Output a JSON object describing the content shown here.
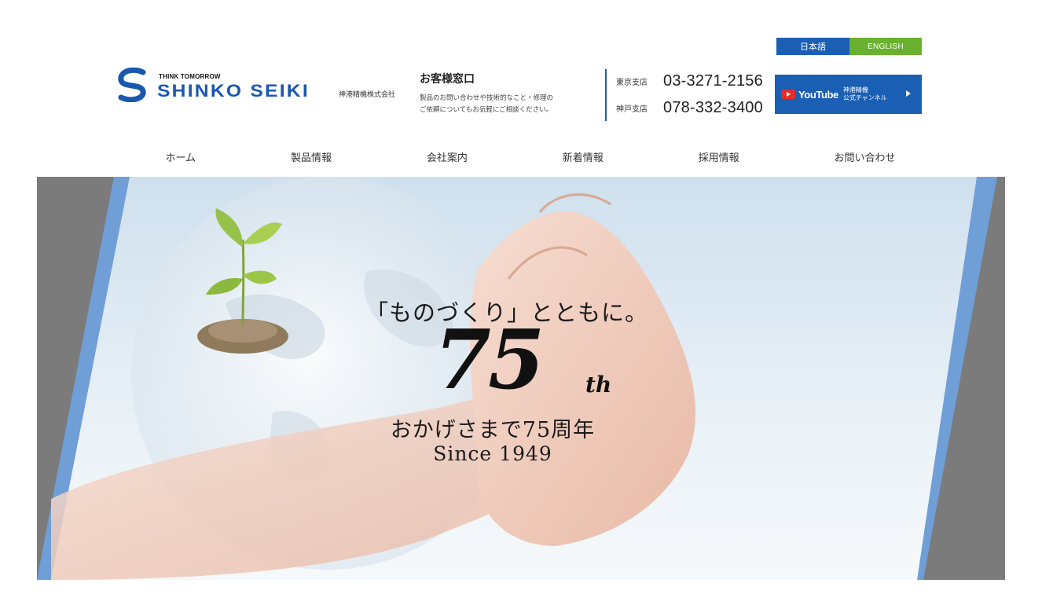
{
  "lang": {
    "japanese": "日本語",
    "english": "ENGLISH"
  },
  "logo": {
    "tagline": "THINK TOMORROW",
    "name": "SHINKO SEIKI",
    "company_jp": "神港精機株式会社"
  },
  "customer": {
    "title": "お客様窓口",
    "desc_line1": "製品のお問い合わせや技術的なこと・修理の",
    "desc_line2": "ご依頼についてもお気軽にご相談ください。"
  },
  "phones": [
    {
      "label": "東京支店",
      "number": "03-3271-2156"
    },
    {
      "label": "神戸支店",
      "number": "078-332-3400"
    }
  ],
  "youtube": {
    "word": "YouTube",
    "line1": "神港精機",
    "line2": "公式チャンネル"
  },
  "nav": [
    "ホーム",
    "製品情報",
    "会社案内",
    "新着情報",
    "採用情報",
    "お問い合わせ"
  ],
  "hero": {
    "catch1": "「ものづくり」とともに。",
    "number": "75",
    "suffix": "th",
    "catch2": "おかげさまで75周年",
    "catch3": "Since 1949"
  },
  "colors": {
    "brand_blue": "#1b5fb4",
    "english_green": "#6ab12f",
    "youtube_red": "#e52d27"
  }
}
